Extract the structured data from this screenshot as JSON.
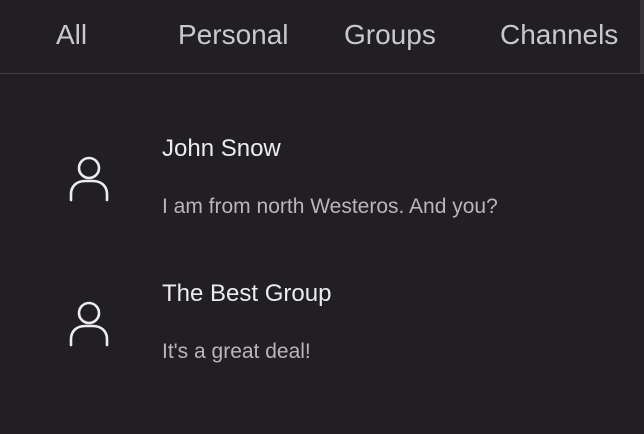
{
  "tabs": [
    {
      "label": "All"
    },
    {
      "label": "Personal"
    },
    {
      "label": "Groups"
    },
    {
      "label": "Channels"
    }
  ],
  "chats": [
    {
      "name": "John Snow",
      "preview": "I am from north Westeros. And you?",
      "avatar_icon": "user-icon"
    },
    {
      "name": "The Best Group",
      "preview": "It's a great deal!",
      "avatar_icon": "user-icon"
    }
  ],
  "colors": {
    "background": "#211f22",
    "tab_text": "#c9c8cb",
    "divider": "#424045",
    "name_text": "#ececee",
    "preview_text": "#b8b6bb"
  }
}
